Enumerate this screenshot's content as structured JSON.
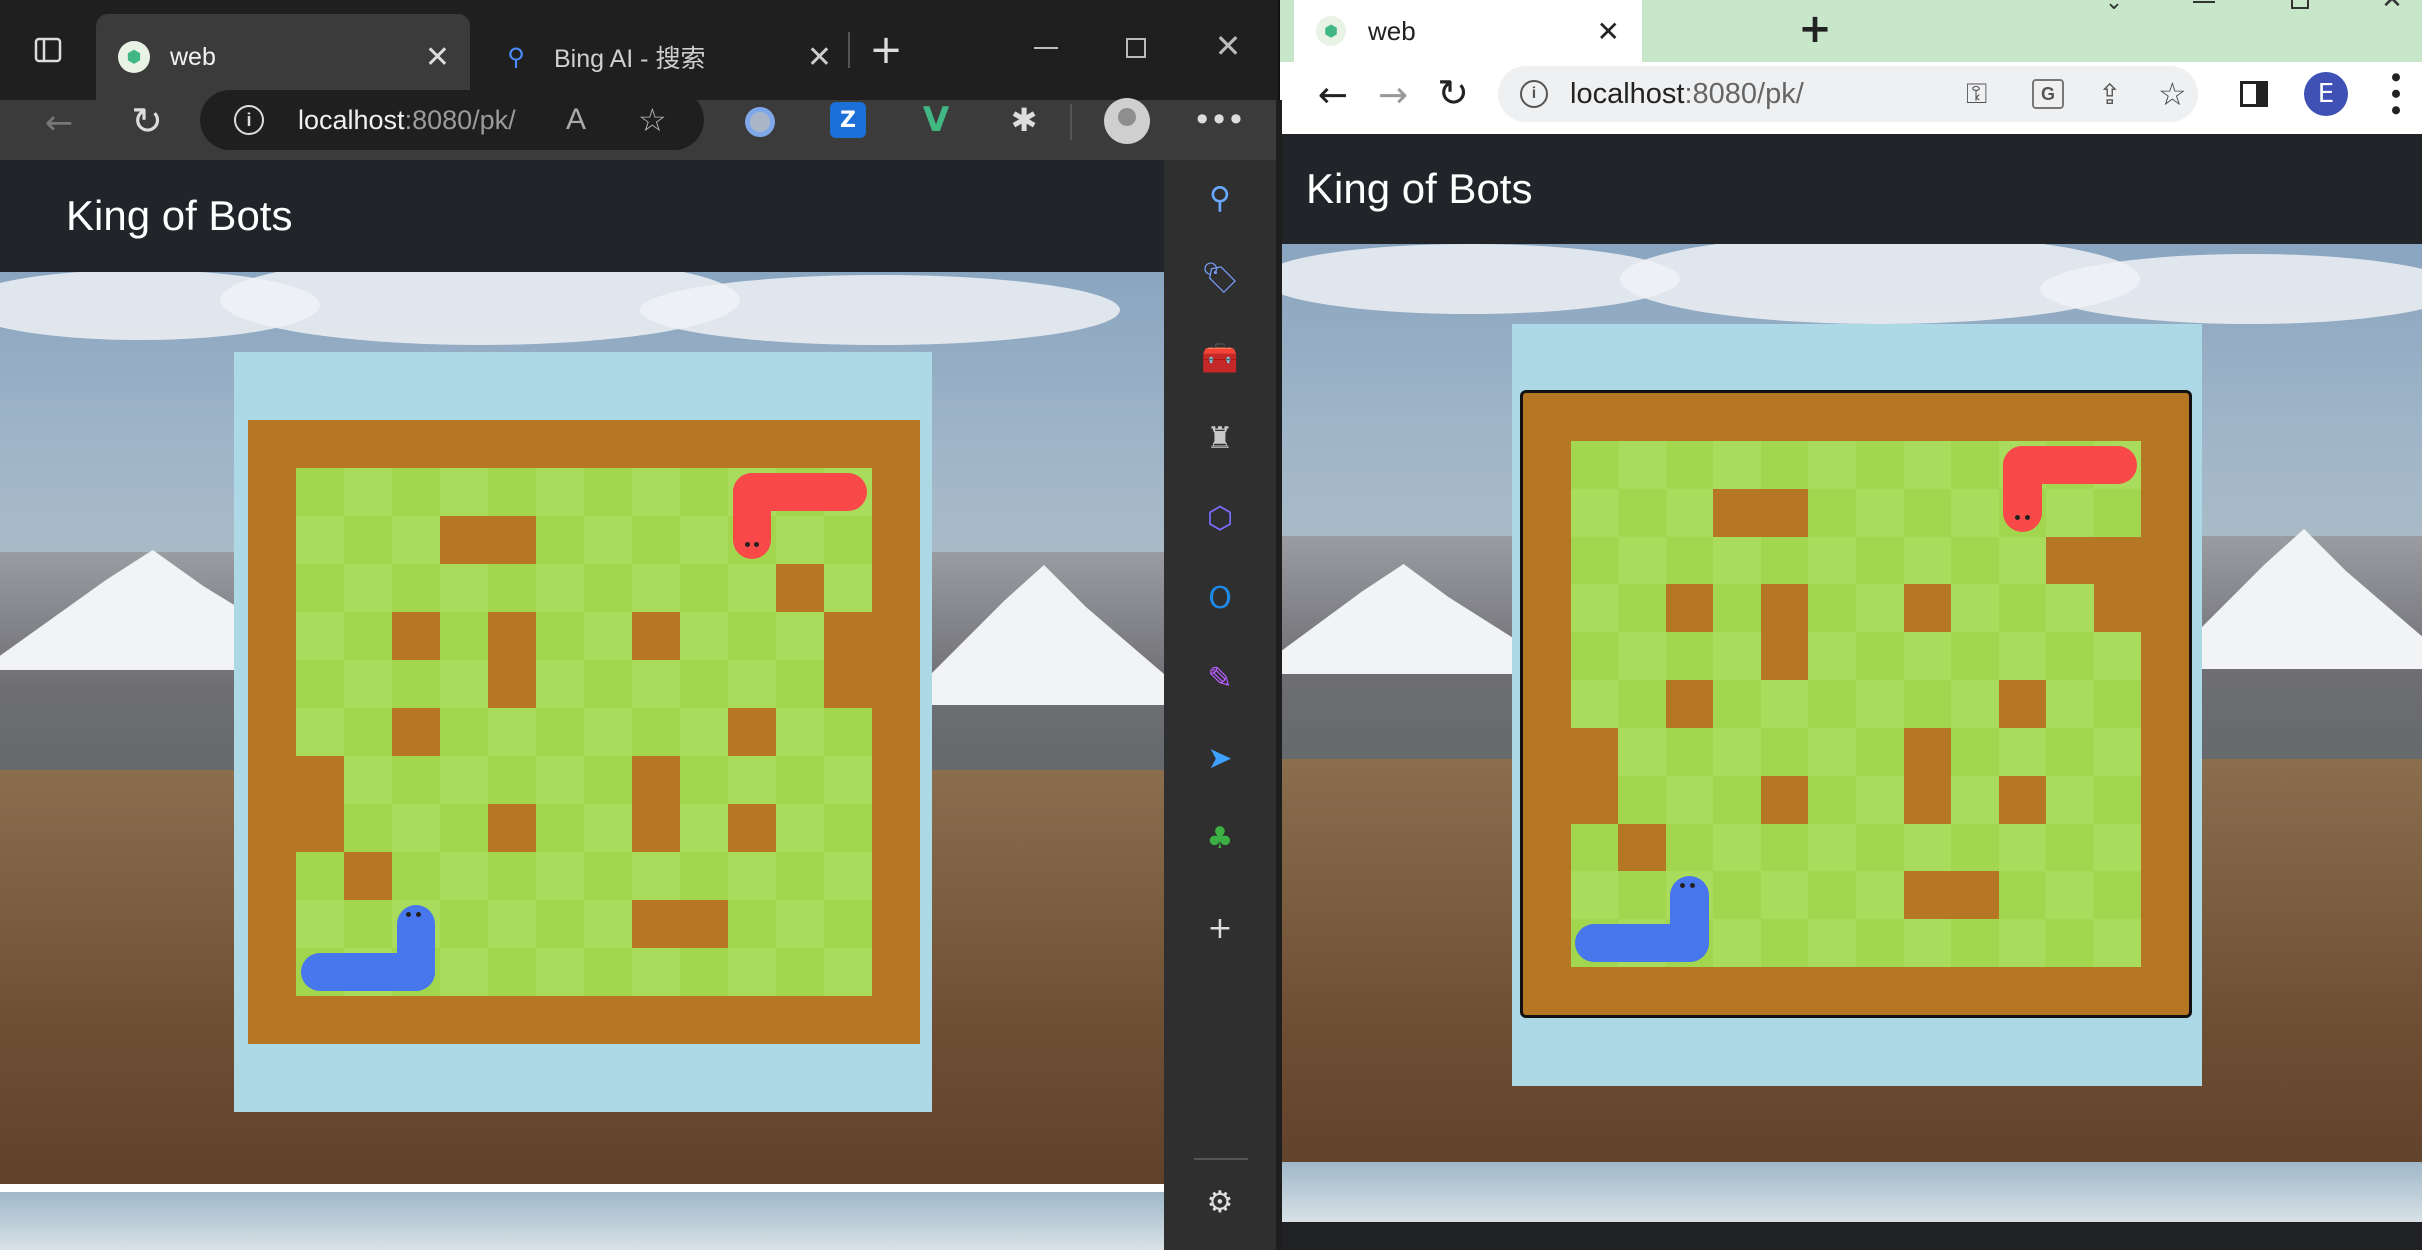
{
  "left_browser": {
    "tabs": [
      {
        "title": "web",
        "active": true
      },
      {
        "title": "Bing AI - 搜索",
        "active": false
      }
    ],
    "address": {
      "host": "localhost",
      "path": ":8080/pk/"
    },
    "sidebar_icons": [
      "search-icon",
      "tag-icon",
      "toolbox-icon",
      "chess-icon",
      "copilot-icon",
      "outlook-icon",
      "designer-icon",
      "send-icon",
      "tree-icon",
      "add-icon",
      "settings-icon"
    ]
  },
  "right_browser": {
    "tabs": [
      {
        "title": "web",
        "active": true
      }
    ],
    "address": {
      "host": "localhost",
      "path": ":8080/pk/"
    },
    "profile_letter": "E"
  },
  "app": {
    "title": "King of Bots"
  },
  "colors": {
    "panel": "#add8e6",
    "wall": "#b67725",
    "grass_a": "#a2d64e",
    "grass_b": "#a9db5c",
    "snake_red": "#f94848",
    "snake_blue": "#4876ec"
  }
}
